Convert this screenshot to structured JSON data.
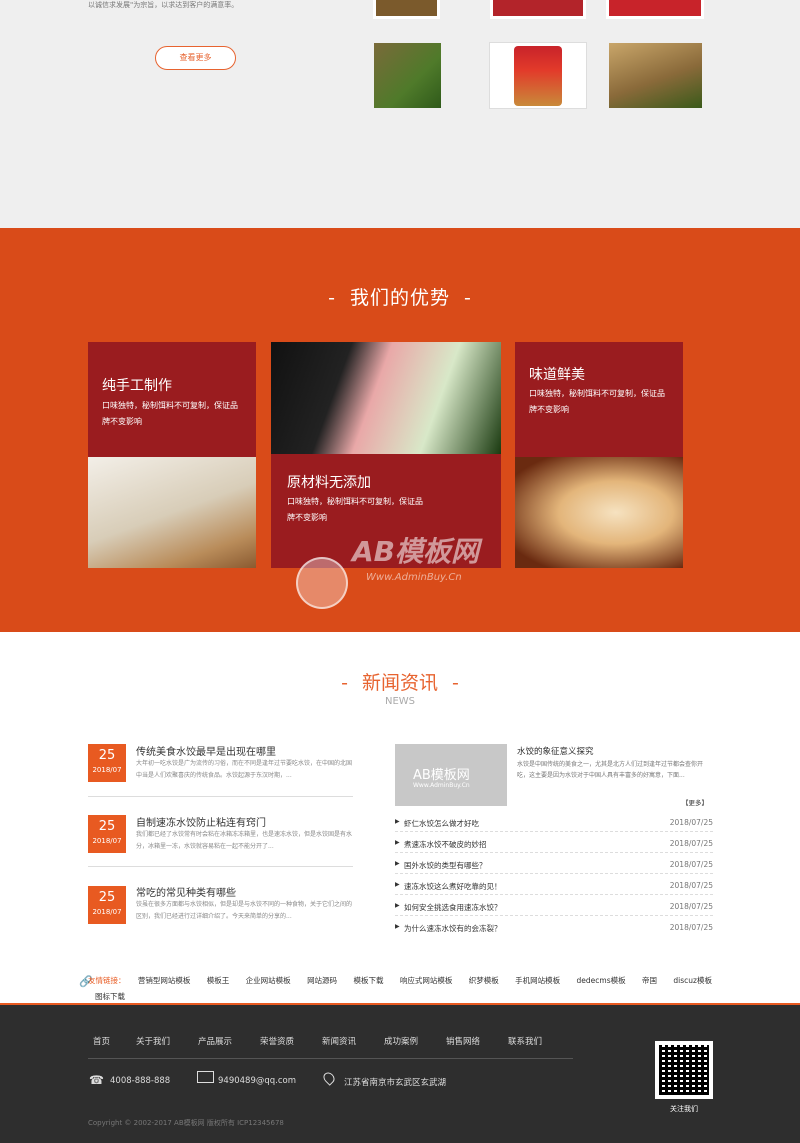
{
  "top": {
    "intro_text": "以诚信求发展\"为宗旨，以求达到客户的满意率。",
    "more_label": "查看更多"
  },
  "advantages": {
    "title": "我们的优势",
    "card1": {
      "heading": "纯手工制作",
      "text": "口味独特，秘制饵料不可复制，保证品牌不变影响"
    },
    "card2": {
      "heading": "原材料无添加",
      "text": "口味独特，秘制饵料不可复制，保证品牌不变影响"
    },
    "card3": {
      "heading": "味道鲜美",
      "text": "口味独特，秘制饵料不可复制，保证品牌不变影响"
    },
    "watermark": "AB模板网",
    "watermark_url": "Www.AdminBuy.Cn"
  },
  "news": {
    "title": "新闻资讯",
    "subtitle": "NEWS",
    "items": [
      {
        "day": "25",
        "ym": "2018/07",
        "title": "传统美食水饺最早是出现在哪里",
        "desc": "大年初一吃水饺是广为流传的习俗，而在不同是逢年过节要吃水饺，在中国的北国中当是人们欢聚喜庆的传统食品。水饺起源于东汉时期，..."
      },
      {
        "day": "25",
        "ym": "2018/07",
        "title": "自制速冻水饺防止粘连有窍门",
        "desc": "我们都已经了水饺常有时会粘在冰箱冻冻箱里，也是速冻水饺，但是水饺固是有水分，冰箱里一冻，水饺就容易粘在一起不能分开了..."
      },
      {
        "day": "25",
        "ym": "2018/07",
        "title": "常吃的常见种类有哪些",
        "desc": "饺虽在很多方面都与水饺相似，但是却是与水饺不同的一种食物，关于它们之间的区别，我们已经进行过详细介绍了。今天来简单的分享的..."
      }
    ],
    "featured": {
      "image_text": "AB模板网",
      "image_subtext": "Www.AdminBuy.Cn",
      "title": "水饺的象征意义探究",
      "desc": "水饺是中国传统的美食之一，尤其是北方人们过到逢年过节都会查你开吃，这主要是因为水饺对于中国人具有丰富多的好寓意，下面...",
      "more_label": "【更多】"
    },
    "list": [
      {
        "title": "虾仁水饺怎么做才好吃",
        "date": "2018/07/25"
      },
      {
        "title": "煮速冻水饺不破皮的妙招",
        "date": "2018/07/25"
      },
      {
        "title": "国外水饺的类型有哪些？",
        "date": "2018/07/25"
      },
      {
        "title": "速冻水饺这么煮好吃靠的见！",
        "date": "2018/07/25"
      },
      {
        "title": "如何安全挑选食用速冻水饺？",
        "date": "2018/07/25"
      },
      {
        "title": "为什么速冻水饺有的会冻裂？",
        "date": "2018/07/25"
      }
    ]
  },
  "links": {
    "label": "友情链接：",
    "items": [
      "营销型网站模板",
      "模板王",
      "企业网站模板",
      "网站源码",
      "模板下载",
      "响应式网站模板",
      "织梦模板",
      "手机网站模板",
      "dedecms模板",
      "帝国",
      "discuz模板",
      "图标下载"
    ]
  },
  "footer": {
    "nav": [
      "首页",
      "关于我们",
      "产品展示",
      "荣誉资质",
      "新闻资讯",
      "成功案例",
      "销售网络",
      "联系我们"
    ],
    "phone": "4008-888-888",
    "email": "9490489@qq.com",
    "address": "江苏省南京市玄武区玄武湖",
    "copyright": "Copyright © 2002-2017 AB模板网 版权所有   ICP12345678",
    "qr_label": "关注我们"
  },
  "colors": {
    "accent": "#e85a21",
    "card": "#9a1c1f",
    "footer": "#2e2e2e"
  }
}
